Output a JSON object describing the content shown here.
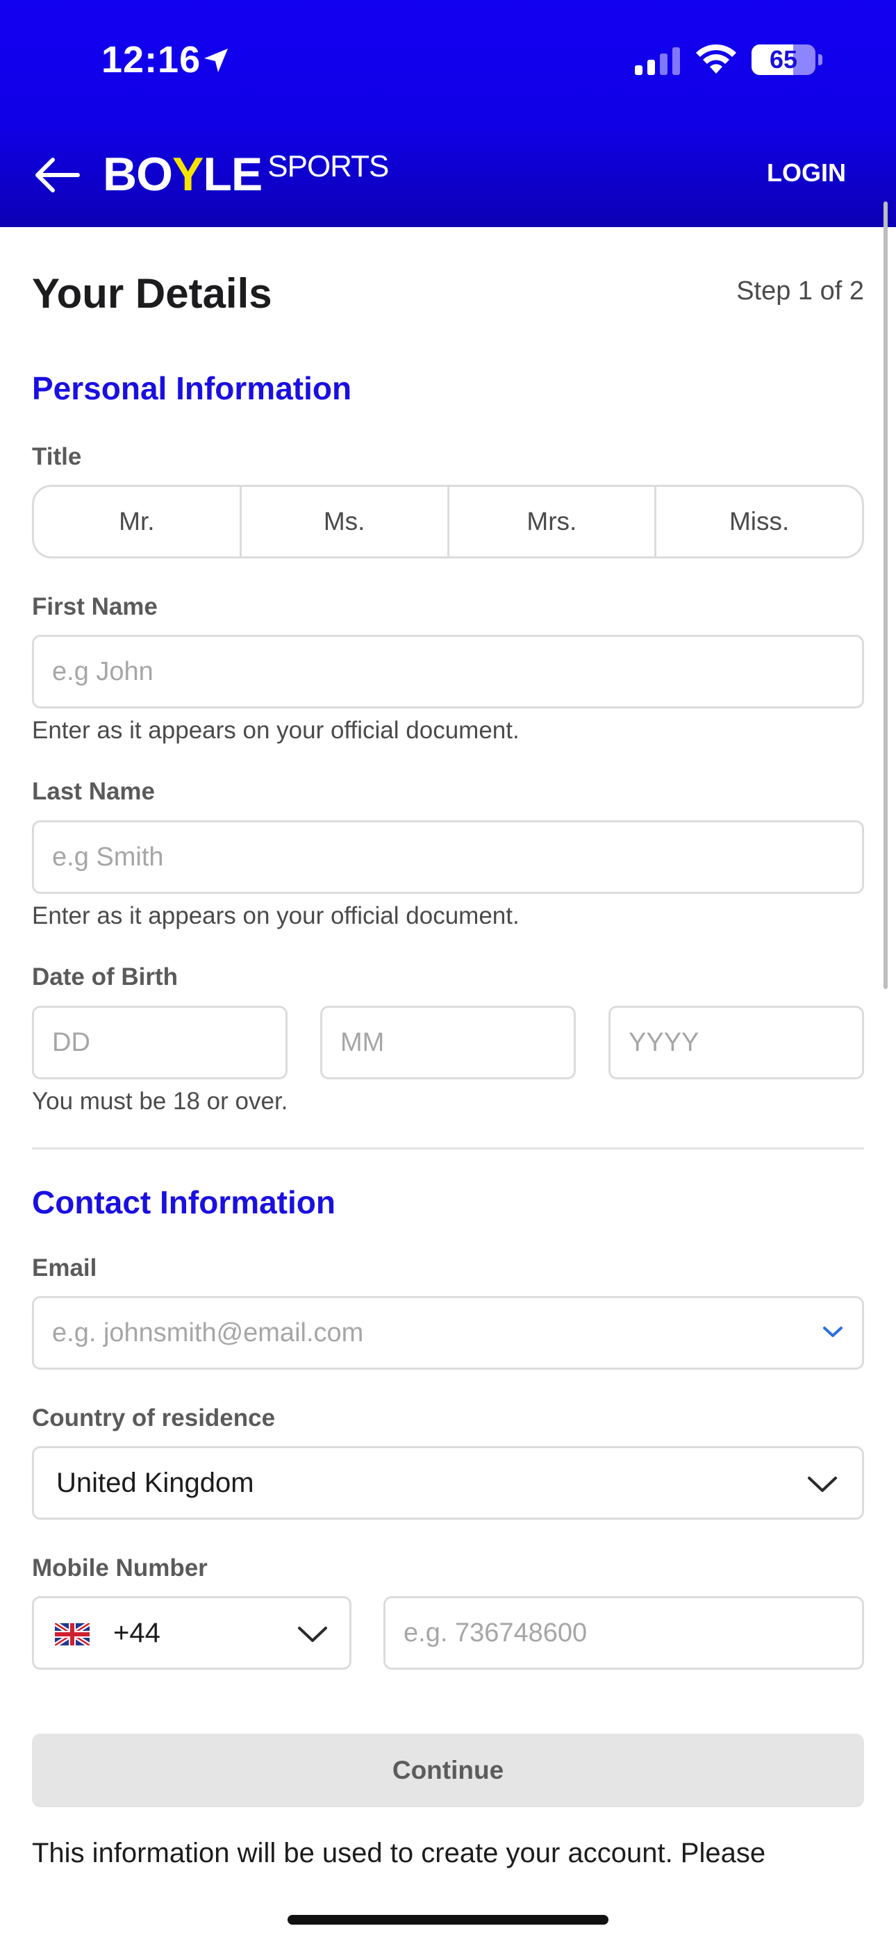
{
  "status_bar": {
    "time": "12:16",
    "battery": "65",
    "battery_level": 0.65
  },
  "header": {
    "brand_main_a": "BO",
    "brand_main_y": "Y",
    "brand_main_b": "LE",
    "brand_sub": "SPORTS",
    "login_label": "LOGIN"
  },
  "page": {
    "title": "Your Details",
    "step": "Step 1 of 2"
  },
  "personal": {
    "section_title": "Personal Information",
    "title_label": "Title",
    "title_options": [
      "Mr.",
      "Ms.",
      "Mrs.",
      "Miss."
    ],
    "first_name": {
      "label": "First Name",
      "placeholder": "e.g John",
      "helper": "Enter as it appears on your official document."
    },
    "last_name": {
      "label": "Last Name",
      "placeholder": "e.g Smith",
      "helper": "Enter as it appears on your official document."
    },
    "dob": {
      "label": "Date of Birth",
      "day_placeholder": "DD",
      "month_placeholder": "MM",
      "year_placeholder": "YYYY",
      "helper": "You must be 18 or over."
    }
  },
  "contact": {
    "section_title": "Contact Information",
    "email": {
      "label": "Email",
      "placeholder": "e.g. johnsmith@email.com"
    },
    "country": {
      "label": "Country of residence",
      "value": "United Kingdom"
    },
    "mobile": {
      "label": "Mobile Number",
      "dial_code": "+44",
      "flag_icon": "uk-flag-icon",
      "placeholder": "e.g. 736748600"
    }
  },
  "continue_label": "Continue",
  "footer_text": "This information will be used to create your account. Please",
  "colors": {
    "brand_blue": "#1200f0",
    "section_blue": "#1a0fe0",
    "accent_yellow": "#f5e400",
    "chevron_blue": "#2d6fe0"
  }
}
